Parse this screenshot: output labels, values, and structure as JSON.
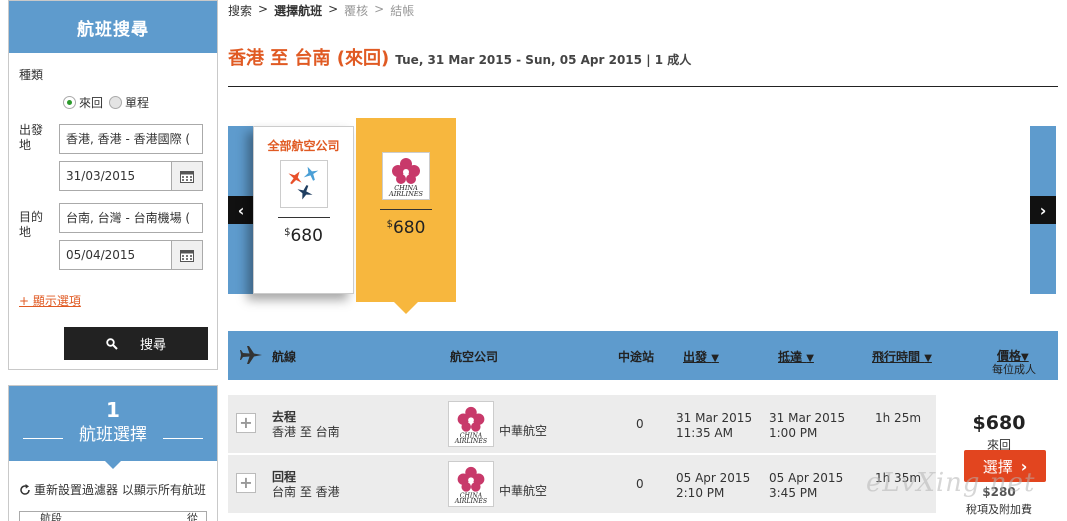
{
  "search_panel": {
    "title": "航班搜尋",
    "trip_type_label": "種類",
    "round_trip": "來回",
    "one_way": "單程",
    "origin_label": "出發地",
    "origin_value": "香港, 香港 - 香港國際 (",
    "depart_date": "31/03/2015",
    "destination_label": "目的地",
    "destination_value": "台南, 台灣 - 台南機場 (",
    "return_date": "05/04/2015",
    "show_options": "+ 顯示選項",
    "search_button": "搜尋"
  },
  "filter_panel": {
    "step": "1",
    "title": "航班選擇",
    "reset_text": "重新設置過濾器 以顯示所有航班",
    "first_item": "航段",
    "first_item_right": "從"
  },
  "breadcrumb": {
    "step1": "搜索",
    "step2": "選擇航班",
    "step3": "覆核",
    "step4": "結帳",
    "sep": ">"
  },
  "header": {
    "title": "香港 至 台南 (來回)",
    "subtitle": "Tue, 31 Mar 2015 - Sun, 05 Apr 2015 | 1 成人"
  },
  "airline_cards": [
    {
      "name": "全部航空公司",
      "currency": "$",
      "price": "680"
    },
    {
      "name": "CHINA AIRLINES",
      "currency": "$",
      "price": "680"
    }
  ],
  "table_header": {
    "segment": "航線",
    "airline": "航空公司",
    "stops": "中途站",
    "depart": "出發",
    "arrive": "抵達",
    "duration": "飛行時間",
    "price": "價格",
    "per_adult": "每位成人",
    "caret": "▼"
  },
  "flights": [
    {
      "direction": "去程",
      "route": "香港 至 台南",
      "airline": "中華航空",
      "logo_text": "CHINA AIRLINES",
      "stops": "0",
      "depart_date": "31 Mar 2015",
      "depart_time": "11:35 AM",
      "arrive_date": "31 Mar 2015",
      "arrive_time": "1:00 PM",
      "duration": "1h 25m"
    },
    {
      "direction": "回程",
      "route": "台南 至 香港",
      "airline": "中華航空",
      "logo_text": "CHINA AIRLINES",
      "stops": "0",
      "depart_date": "05 Apr 2015",
      "depart_time": "2:10 PM",
      "arrive_date": "05 Apr 2015",
      "arrive_time": "3:45 PM",
      "duration": "1h 35m"
    }
  ],
  "price_box": {
    "amount": "$680",
    "type": "來回",
    "select_button": "選擇",
    "small_amount": "$280",
    "tax_note": "稅項及附加費"
  },
  "watermark": "eLvXing.net",
  "colors": {
    "header_blue": "#5e9bcd",
    "accent_orange": "#e05a23",
    "card_gold": "#f7b73e",
    "select_red": "#e2451f"
  },
  "icons": {
    "calendar": "calendar-icon",
    "search": "magnifier-icon",
    "plane": "plane-icon",
    "reset": "refresh-icon",
    "prev": "chevron-left-icon",
    "next": "chevron-right-icon",
    "expand": "plus-icon"
  }
}
